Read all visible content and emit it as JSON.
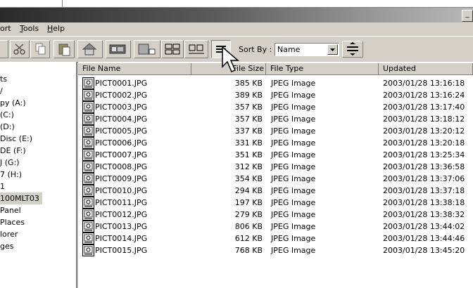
{
  "menu": [
    {
      "label": "ort",
      "underline": ""
    },
    {
      "label": "ools",
      "underline": "T"
    },
    {
      "label": "elp",
      "underline": "H"
    }
  ],
  "window": {
    "min_glyph": "_"
  },
  "toolbar": {
    "sort_by_label": "Sort By :",
    "sort_value": "Name"
  },
  "tree": [
    {
      "label": "ts"
    },
    {
      "label": "/"
    },
    {
      "label": "py (A:)"
    },
    {
      "label": " (C:)"
    },
    {
      "label": " (D:)"
    },
    {
      "label": " Disc (E:)"
    },
    {
      "label": "DE (F:)"
    },
    {
      "label": "J (G:)"
    },
    {
      "label": "7 (H:)"
    },
    {
      "label": "1"
    },
    {
      "label": "100MLT03",
      "selected": true
    },
    {
      "label": "Panel"
    },
    {
      "label": "Places"
    },
    {
      "label": "lorer"
    },
    {
      "label": "ges"
    }
  ],
  "columns": {
    "name": "File Name",
    "size": "File Size",
    "type": "File Type",
    "updated": "Updated"
  },
  "files": [
    {
      "name": "PICT0001.JPG",
      "size": "385 KB",
      "type": "JPEG Image",
      "updated": "2003/01/28 13:16:18"
    },
    {
      "name": "PICT0002.JPG",
      "size": "389 KB",
      "type": "JPEG Image",
      "updated": "2003/01/28 13:16:24"
    },
    {
      "name": "PICT0003.JPG",
      "size": "357 KB",
      "type": "JPEG Image",
      "updated": "2003/01/28 13:17:40"
    },
    {
      "name": "PICT0004.JPG",
      "size": "357 KB",
      "type": "JPEG Image",
      "updated": "2003/01/28 13:18:12"
    },
    {
      "name": "PICT0005.JPG",
      "size": "337 KB",
      "type": "JPEG Image",
      "updated": "2003/01/28 13:20:12"
    },
    {
      "name": "PICT0006.JPG",
      "size": "331 KB",
      "type": "JPEG Image",
      "updated": "2003/01/28 13:20:18"
    },
    {
      "name": "PICT0007.JPG",
      "size": "351 KB",
      "type": "JPEG Image",
      "updated": "2003/01/28 13:25:34"
    },
    {
      "name": "PICT0008.JPG",
      "size": "312 KB",
      "type": "JPEG Image",
      "updated": "2003/01/28 13:36:58"
    },
    {
      "name": "PICT0009.JPG",
      "size": "354 KB",
      "type": "JPEG Image",
      "updated": "2003/01/28 13:37:06"
    },
    {
      "name": "PICT0010.JPG",
      "size": "294 KB",
      "type": "JPEG Image",
      "updated": "2003/01/28 13:37:18"
    },
    {
      "name": "PICT0011.JPG",
      "size": "197 KB",
      "type": "JPEG Image",
      "updated": "2003/01/28 13:38:18"
    },
    {
      "name": "PICT0012.JPG",
      "size": "279 KB",
      "type": "JPEG Image",
      "updated": "2003/01/28 13:38:32"
    },
    {
      "name": "PICT0013.JPG",
      "size": "806 KB",
      "type": "JPEG Image",
      "updated": "2003/01/28 13:44:02"
    },
    {
      "name": "PICT0014.JPG",
      "size": "612 KB",
      "type": "JPEG Image",
      "updated": "2003/01/28 13:44:46"
    },
    {
      "name": "PICT0015.JPG",
      "size": "768 KB",
      "type": "JPEG Image",
      "updated": "2003/01/28 13:45:20"
    }
  ]
}
